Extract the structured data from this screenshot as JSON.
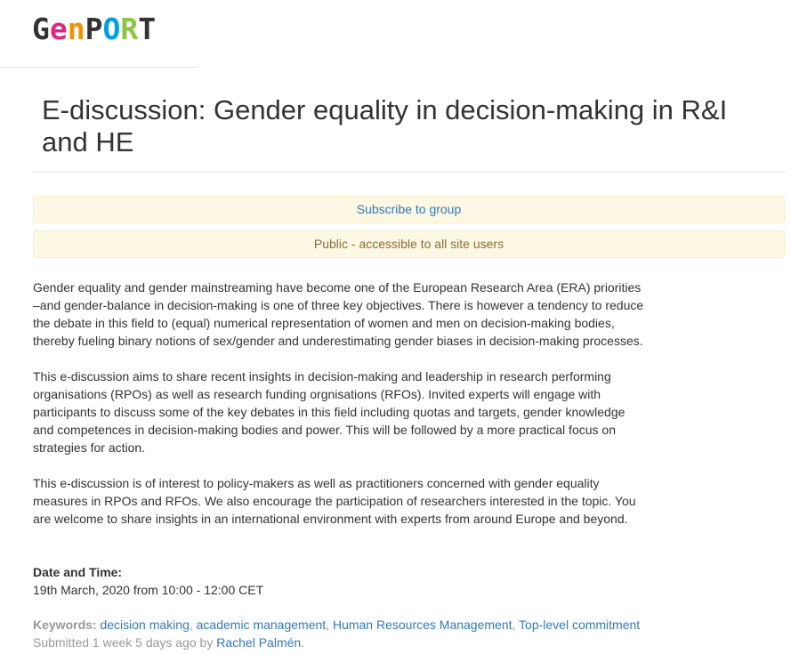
{
  "site": {
    "logo_text": "GenPORT",
    "logo_colors": {
      "G": "#333333",
      "e": "#e0267d",
      "n": "#f39200",
      "P": "#333333",
      "O": "#009fe3",
      "R": "#8cc63f",
      "T": "#333333"
    }
  },
  "page": {
    "title": "E-discussion: Gender equality in decision-making in R&I and HE"
  },
  "notices": {
    "subscribe_label": "Subscribe to group",
    "public_label": "Public - accessible to all site users"
  },
  "body": {
    "paragraphs": [
      "Gender equality and gender mainstreaming have become one of the European Research Area (ERA) priorities –and gender-balance in decision-making is one of three key objectives. There is however a tendency to reduce the debate in this field to (equal) numerical representation of women and men on decision-making bodies, thereby fueling binary notions of sex/gender and underestimating gender biases in decision-making processes.",
      "This e-discussion aims to share recent insights in decision-making and leadership in research performing organisations (RPOs) as well as research funding orgnisations (RFOs). Invited experts will engage with participants to discuss some of the key debates in this field including quotas and targets, gender knowledge and competences in decision-making bodies and power. This will be followed by a more practical focus on strategies for action.",
      "This e-discussion is of interest to policy-makers as well as practitioners concerned with gender equality measures in RPOs and RFOs. We also encourage the participation of researchers interested in the topic. You are welcome to share insights in an international environment with experts from around Europe and beyond."
    ]
  },
  "event": {
    "date_label": "Date and Time:",
    "date_value": "19th March, 2020  from 10:00 - 12:00 CET"
  },
  "meta": {
    "keywords_label": "Keywords:",
    "keywords": [
      "decision making",
      "academic management",
      "Human Resources Management",
      "Top-level commitment"
    ],
    "separator": ", ",
    "submitted_prefix": "Submitted 1 week 5 days ago by ",
    "author": "Rachel Palmén",
    "submitted_suffix": "."
  }
}
